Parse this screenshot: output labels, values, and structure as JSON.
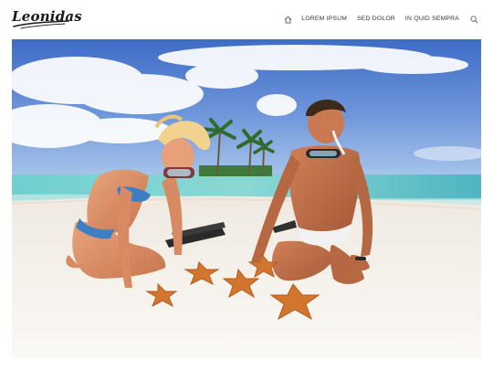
{
  "site": {
    "logo_text": "Leonidas"
  },
  "nav": {
    "home_icon": "home-icon",
    "items": [
      {
        "label": "LOREM IPSUM"
      },
      {
        "label": "SED DOLOR"
      },
      {
        "label": "IN QUID SEMPRA"
      }
    ],
    "search_icon": "search-icon"
  },
  "hero": {
    "subject": "beach-photo",
    "colors": {
      "sky_top": "#3f6fc9",
      "sky_bottom": "#9fc0e8",
      "sea": "#5fc3c4",
      "sand": "#f4f0ea"
    }
  }
}
